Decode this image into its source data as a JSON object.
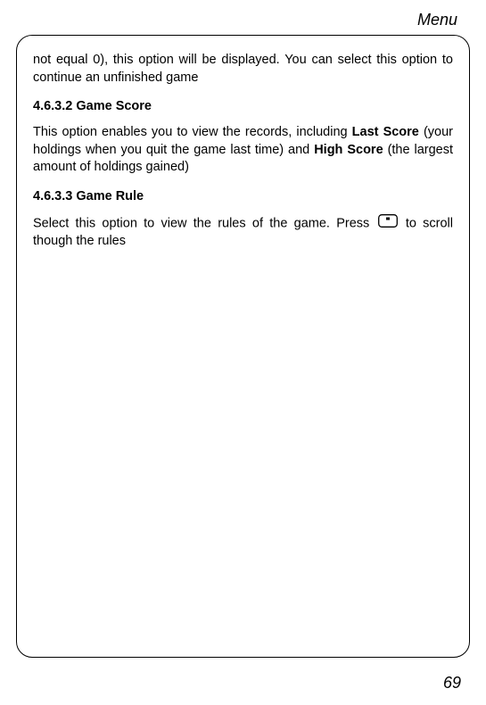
{
  "header": {
    "title": "Menu"
  },
  "body": {
    "para1": "not equal 0), this option will be displayed. You can select this option to continue an unfinished game",
    "heading1": "4.6.3.2 Game Score",
    "para2_prefix": "This option enables you to view the records, including ",
    "para2_bold1": "Last Score",
    "para2_mid": " (your holdings when you quit the game last time) and ",
    "para2_bold2": "High Score",
    "para2_suffix": " (the largest amount of holdings gained)",
    "heading2": "4.6.3.3 Game Rule",
    "para3_prefix": "Select this option to view the rules of the game. Press ",
    "para3_suffix": " to scroll though the rules"
  },
  "footer": {
    "page_number": "69"
  }
}
